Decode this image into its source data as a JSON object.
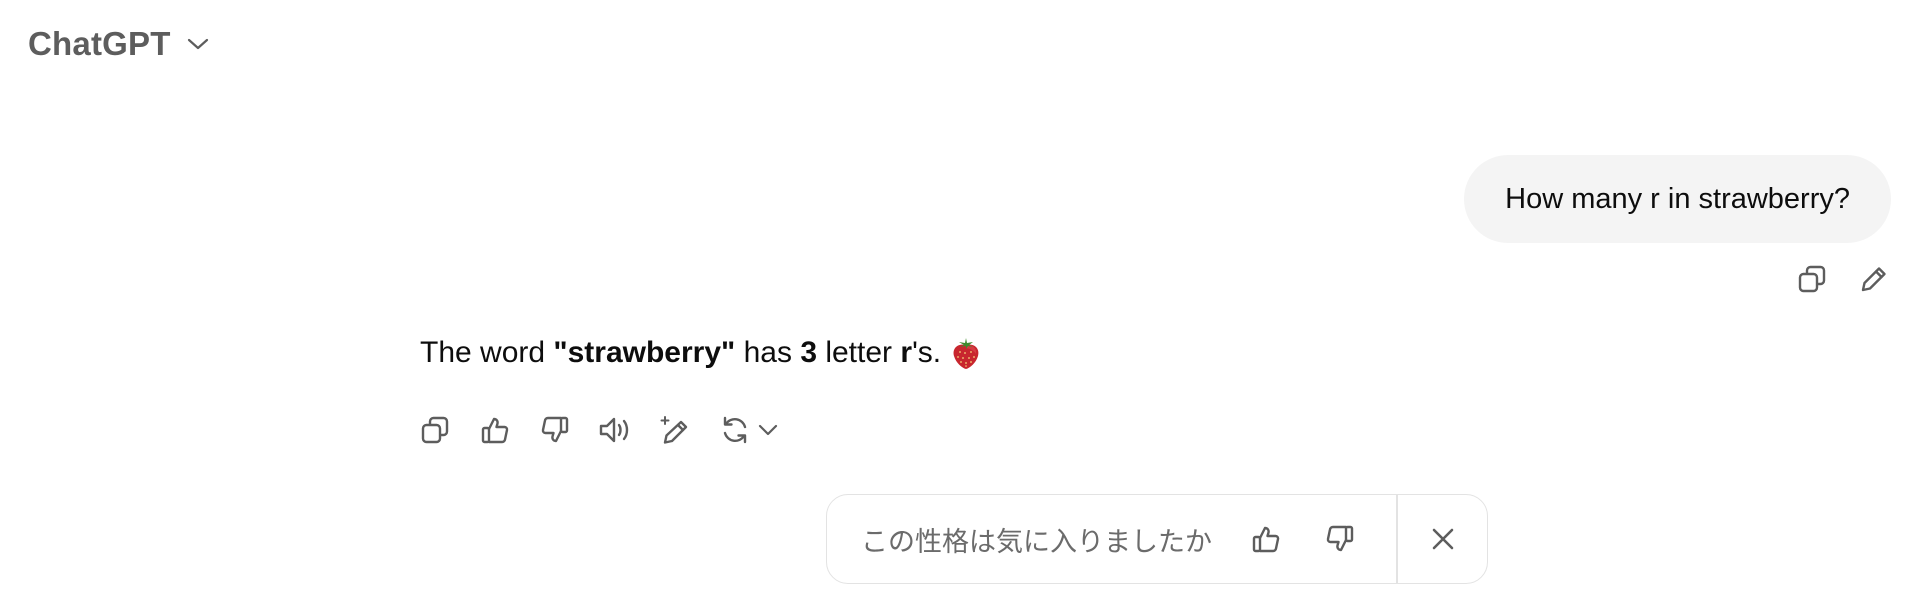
{
  "header": {
    "model_name": "ChatGPT",
    "dropdown_icon": "chevron-down-icon"
  },
  "user_message": {
    "text": "How many r in strawberry?",
    "actions": [
      {
        "icon": "copy-icon",
        "label": "Copy"
      },
      {
        "icon": "edit-icon",
        "label": "Edit message"
      }
    ]
  },
  "assistant_message": {
    "part1": "The word ",
    "word": "\"strawberry\"",
    "part2": " has ",
    "count": "3",
    "part3": " letter ",
    "letter": "r",
    "part4": "'s.",
    "emoji_icon": "strawberry-icon",
    "actions": [
      {
        "icon": "copy-icon"
      },
      {
        "icon": "thumbs-up-icon"
      },
      {
        "icon": "thumbs-down-icon"
      },
      {
        "icon": "read-aloud-icon"
      },
      {
        "icon": "edit-sparkle-icon"
      },
      {
        "icon": "regenerate-icon"
      }
    ]
  },
  "feedback": {
    "prompt": "この性格は気に入りましたか",
    "thumbs_up_icon": "thumbs-up-icon",
    "thumbs_down_icon": "thumbs-down-icon",
    "close_icon": "close-icon"
  },
  "colors": {
    "bubble_bg": "#f4f4f4",
    "icon": "#5d5d5d",
    "text": "#0d0d0d",
    "muted": "#6b6b6b",
    "border": "#e3e3e3"
  }
}
